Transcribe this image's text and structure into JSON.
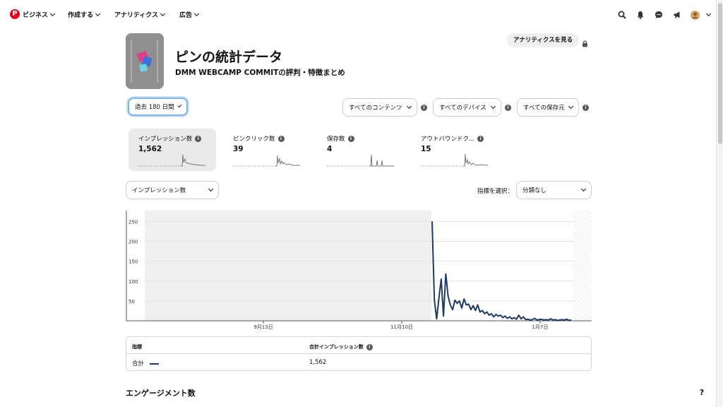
{
  "nav": {
    "items": [
      "ビジネス",
      "作成する",
      "アナリティクス",
      "広告"
    ]
  },
  "icons": [
    "pinterest-logo-icon",
    "search-icon",
    "bell-icon",
    "chat-icon",
    "megaphone-icon",
    "avatar",
    "chevron-down-icon"
  ],
  "pin": {
    "title": "ピンの統計データ",
    "subtitle": "DMM WEBCAMP COMMITの評判・特徴まとめ",
    "analytics_button": "アナリティクスを見る"
  },
  "filters": {
    "date_range": "過去 180 日間",
    "content": "すべてのコンテンツ",
    "device": "すべてのデバイス",
    "source": "すべての保存元"
  },
  "metrics": [
    {
      "label": "インプレッション数",
      "value": "1,562",
      "active": true
    },
    {
      "label": "ピンクリック数",
      "value": "39",
      "active": false
    },
    {
      "label": "保存数",
      "value": "4",
      "active": false
    },
    {
      "label": "アウトバウンドク...",
      "value": "15",
      "active": false
    }
  ],
  "controls": {
    "metric_select": "インプレッション数",
    "split_label": "指標を選択：",
    "split_select": "分類なし"
  },
  "colors": {
    "line": "#1e3a5f",
    "accent": "#e60023",
    "focus": "#79b4ee"
  },
  "chart_data": {
    "type": "line",
    "x_labels": [
      "9月13日",
      "11月10日",
      "1月7日"
    ],
    "y_ticks": [
      50,
      100,
      150,
      200,
      250
    ],
    "ylim": [
      0,
      280
    ],
    "grid": true,
    "series": [
      {
        "values": [
          250,
          52,
          5,
          58,
          105,
          12,
          118,
          62,
          40,
          28,
          52,
          44,
          50,
          32,
          55,
          40,
          42,
          28,
          38,
          26,
          40,
          22,
          26,
          18,
          22,
          14,
          18,
          10,
          16,
          12,
          14,
          8,
          12,
          6,
          10,
          5,
          8,
          4,
          14,
          5,
          10,
          3,
          4,
          2,
          3,
          6,
          2,
          3,
          4,
          2,
          3,
          2,
          5,
          2,
          3,
          1,
          2,
          3,
          2,
          4,
          1,
          2
        ]
      }
    ]
  },
  "table": {
    "col_metric": "指標",
    "col_total": "合計インプレッション数",
    "row_label": "合計",
    "row_value": "1,562"
  },
  "section_title": "エンゲージメント数",
  "help_label": "?"
}
